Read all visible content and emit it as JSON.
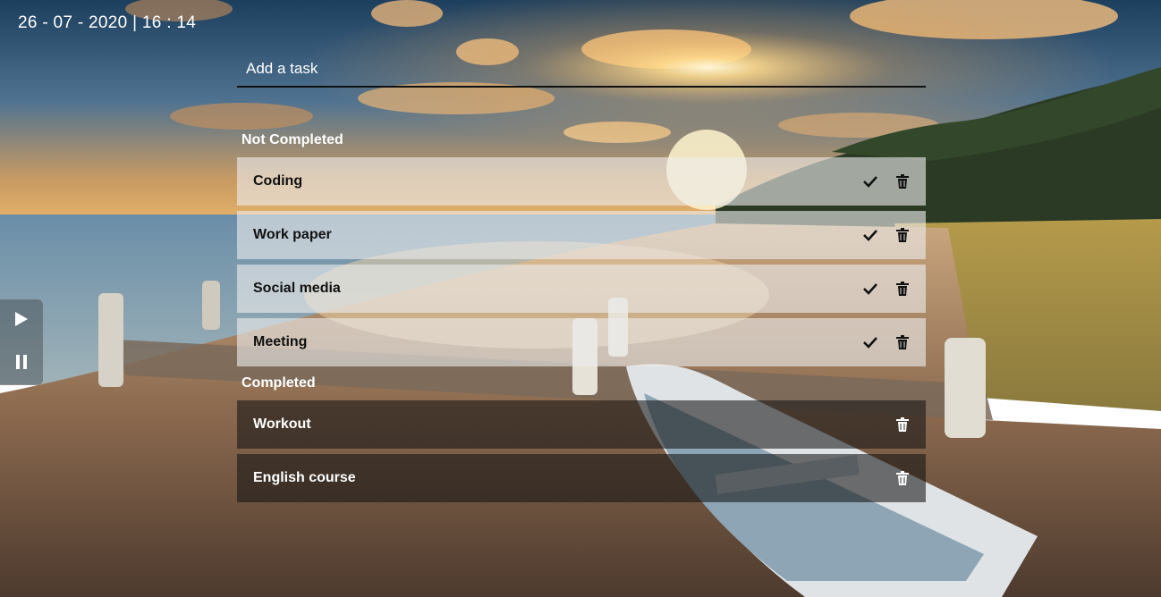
{
  "clock": {
    "text": "26 - 07 - 2020 | 16 : 14"
  },
  "add_task": {
    "placeholder": "Add a task"
  },
  "sections": {
    "not_completed": "Not Completed",
    "completed": "Completed"
  },
  "tasks_not_completed": [
    {
      "label": "Coding"
    },
    {
      "label": "Work paper"
    },
    {
      "label": "Social media"
    },
    {
      "label": "Meeting"
    }
  ],
  "tasks_completed": [
    {
      "label": "Workout"
    },
    {
      "label": "English course"
    }
  ],
  "icons": {
    "complete": "check-icon",
    "delete": "trash-icon",
    "play": "play-icon",
    "pause": "pause-icon"
  },
  "colors": {
    "pending_row": "#ebebeb",
    "done_row": "#141414",
    "text_light": "#ffffff"
  }
}
